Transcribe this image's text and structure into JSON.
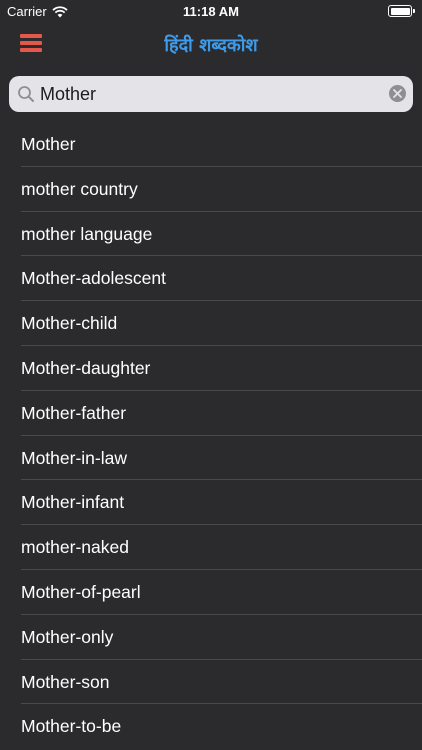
{
  "status_bar": {
    "carrier": "Carrier",
    "time": "11:18 AM",
    "icons": [
      "wifi-icon",
      "battery-icon"
    ]
  },
  "nav": {
    "title": "हिंदी शब्दकोश",
    "menu_icon": "hamburger-menu-icon",
    "title_color": "#3d9bea",
    "menu_color": "#e4574b"
  },
  "search": {
    "value": "Mother",
    "icons": [
      "search-icon",
      "clear-icon"
    ]
  },
  "results": [
    "Mother",
    "mother country",
    "mother language",
    "Mother-adolescent",
    "Mother-child",
    "Mother-daughter",
    "Mother-father",
    "Mother-in-law",
    "Mother-infant",
    "mother-naked",
    "Mother-of-pearl",
    "Mother-only",
    "Mother-son",
    "Mother-to-be"
  ]
}
